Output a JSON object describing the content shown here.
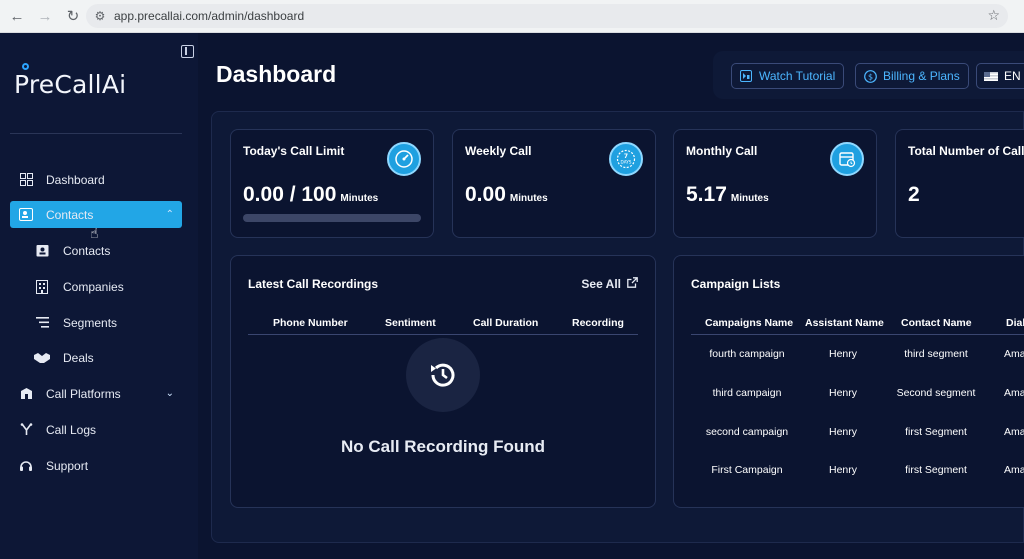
{
  "browser": {
    "url": "app.precallai.com/admin/dashboard"
  },
  "sidebar": {
    "logo_text": "PreCallAi",
    "items": [
      {
        "label": "Dashboard",
        "icon": "grid-icon"
      },
      {
        "label": "Contacts",
        "icon": "contacts-icon",
        "active": true,
        "expanded": true
      },
      {
        "label": "Call Platforms",
        "icon": "platform-icon"
      },
      {
        "label": "Call Logs",
        "icon": "call-logs-icon"
      },
      {
        "label": "Support",
        "icon": "support-icon"
      }
    ],
    "sub_items": [
      {
        "label": "Contacts",
        "icon": "contact-card-icon"
      },
      {
        "label": "Companies",
        "icon": "building-icon"
      },
      {
        "label": "Segments",
        "icon": "segments-icon"
      },
      {
        "label": "Deals",
        "icon": "handshake-icon"
      }
    ]
  },
  "header": {
    "title": "Dashboard",
    "watch_tutorial": "Watch Tutorial",
    "billing": "Billing & Plans",
    "language": "EN"
  },
  "stats": [
    {
      "title": "Today's Call Limit",
      "value": "0.00 / 100",
      "unit": "Minutes",
      "progress": 0.0,
      "icon": "speedometer-icon"
    },
    {
      "title": "Weekly Call",
      "value": "0.00",
      "unit": "Minutes",
      "icon": "seven-days-icon"
    },
    {
      "title": "Monthly Call",
      "value": "5.17",
      "unit": "Minutes",
      "icon": "calendar-icon"
    },
    {
      "title": "Total Number of Calls",
      "value": "2",
      "unit": "",
      "icon": ""
    }
  ],
  "recordings": {
    "title": "Latest Call Recordings",
    "see_all": "See All",
    "columns": [
      "Phone Number",
      "Sentiment",
      "Call Duration",
      "Recording"
    ],
    "empty_text": "No Call Recording Found"
  },
  "campaigns": {
    "title": "Campaign Lists",
    "columns": [
      "Campaigns Name",
      "Assistant Name",
      "Contact Name",
      "Dial"
    ],
    "rows": [
      [
        "fourth campaign",
        "Henry",
        "third segment",
        "Ama"
      ],
      [
        "third campaign",
        "Henry",
        "Second segment",
        "Ama"
      ],
      [
        "second campaign",
        "Henry",
        "first Segment",
        "Ama"
      ],
      [
        "First Campaign",
        "Henry",
        "first Segment",
        "Ama"
      ]
    ]
  },
  "colors": {
    "accent": "#22a6e6",
    "link": "#4cb6ff",
    "background": "#0b1430"
  }
}
